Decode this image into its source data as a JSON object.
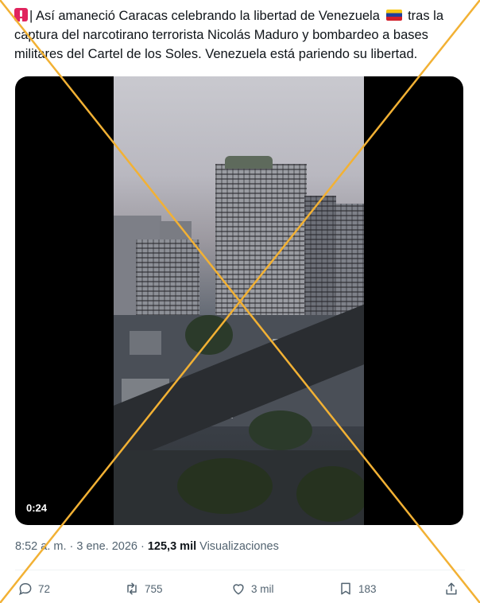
{
  "tweet": {
    "text_line1_after_emoji": "| Así amaneció Caracas celebrando la libertad de Venezuela",
    "text_line1_end": "tras la",
    "text_line2": "captura del narcotirano terrorista Nicolás Maduro y bombardeo a bases",
    "text_line3": "militares del Cartel de los Soles. Venezuela está pariendo su libertad."
  },
  "video": {
    "duration": "0:24"
  },
  "meta": {
    "time_date": "8:52 a. m. · 3 ene. 2026 ·",
    "views_count": "125,3 mil",
    "views_label": "Visualizaciones"
  },
  "actions": {
    "replies": "72",
    "reposts": "755",
    "likes": "3 mil",
    "bookmarks": "183"
  },
  "overlay": {
    "cross_color": "#f2b134"
  },
  "icons": [
    "siren-emoji-icon",
    "venezuela-flag-icon",
    "reply-icon",
    "repost-icon",
    "like-icon",
    "bookmark-icon",
    "share-icon"
  ]
}
